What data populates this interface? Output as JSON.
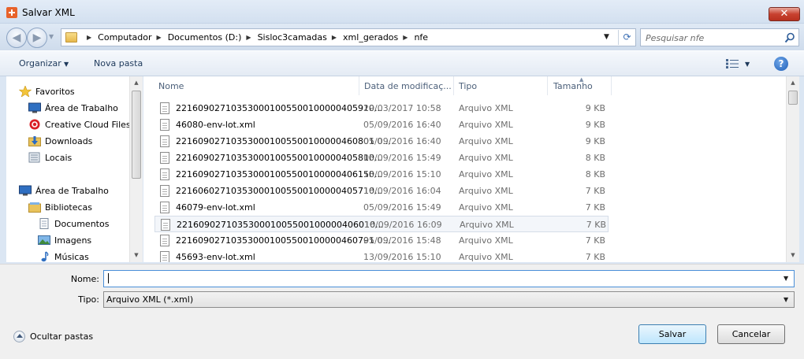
{
  "window": {
    "title": "Salvar XML",
    "close_glyph": "✕"
  },
  "nav_buttons": {
    "back_glyph": "◀",
    "forward_glyph": "▶",
    "refresh_glyph": "⟳"
  },
  "address": {
    "crumbs": [
      "Computador",
      "Documentos (D:)",
      "Sisloc3camadas",
      "xml_gerados",
      "nfe"
    ]
  },
  "search": {
    "placeholder": "Pesquisar nfe"
  },
  "toolbar": {
    "organize_label": "Organizar",
    "new_folder_label": "Nova pasta",
    "help_glyph": "?"
  },
  "sidebar": {
    "items": [
      {
        "label": "Favoritos",
        "icon": "star-icon"
      },
      {
        "label": "Área de Trabalho",
        "icon": "desktop-icon"
      },
      {
        "label": "Creative Cloud Files",
        "icon": "creative-cloud-icon"
      },
      {
        "label": "Downloads",
        "icon": "downloads-icon"
      },
      {
        "label": "Locais",
        "icon": "recent-places-icon"
      },
      {
        "label": "Área de Trabalho",
        "icon": "desktop-icon"
      },
      {
        "label": "Bibliotecas",
        "icon": "libraries-icon"
      },
      {
        "label": "Documentos",
        "icon": "documents-icon"
      },
      {
        "label": "Imagens",
        "icon": "pictures-icon"
      },
      {
        "label": "Músicas",
        "icon": "music-icon"
      }
    ]
  },
  "columns": {
    "name": "Nome",
    "date": "Data de modificaç...",
    "type": "Tipo",
    "size": "Tamanho"
  },
  "files": [
    {
      "name": "221609027103530001005500100000405910...",
      "date": "29/03/2017 10:58",
      "type": "Arquivo XML",
      "size": "9 KB"
    },
    {
      "name": "46080-env-lot.xml",
      "date": "05/09/2016 16:40",
      "type": "Arquivo XML",
      "size": "9 KB"
    },
    {
      "name": "221609027103530001005500100000460801 0...",
      "date": "05/09/2016 16:40",
      "type": "Arquivo XML",
      "size": "9 KB"
    },
    {
      "name": "221609027103530001005500100000405810...",
      "date": "05/09/2016 15:49",
      "type": "Arquivo XML",
      "size": "8 KB"
    },
    {
      "name": "221609027103530001005500100000406150...",
      "date": "13/09/2016 15:10",
      "type": "Arquivo XML",
      "size": "8 KB"
    },
    {
      "name": "221606027103530001005500100000405710...",
      "date": "16/09/2016 16:04",
      "type": "Arquivo XML",
      "size": "7 KB"
    },
    {
      "name": "46079-env-lot.xml",
      "date": "05/09/2016 15:49",
      "type": "Arquivo XML",
      "size": "7 KB"
    },
    {
      "name": "221609027103530001005500100000406010...",
      "date": "16/09/2016 16:09",
      "type": "Arquivo XML",
      "size": "7 KB"
    },
    {
      "name": "221609027103530001005500100000460791 0...",
      "date": "05/09/2016 15:48",
      "type": "Arquivo XML",
      "size": "7 KB"
    },
    {
      "name": "45693-env-lot.xml",
      "date": "13/09/2016 15:10",
      "type": "Arquivo XML",
      "size": "7 KB"
    }
  ],
  "selected_file_index": 7,
  "form": {
    "name_label": "Nome:",
    "name_value": "",
    "type_label": "Tipo:",
    "type_value": "Arquivo XML (*.xml)"
  },
  "footer": {
    "hide_folders_label": "Ocultar pastas",
    "save_label": "Salvar",
    "cancel_label": "Cancelar"
  }
}
